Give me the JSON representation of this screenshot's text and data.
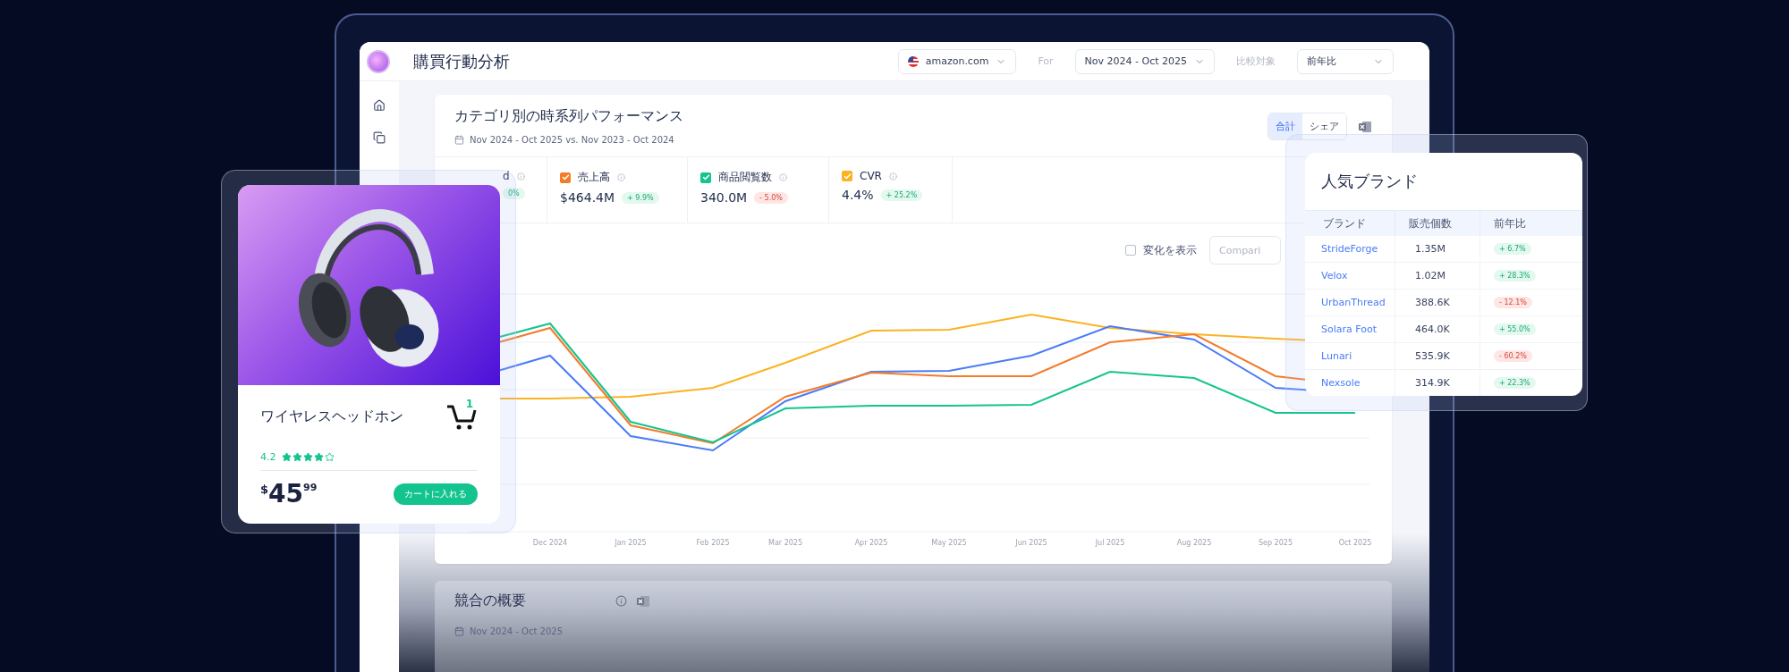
{
  "app": {
    "title": "購買行動分析",
    "marketplace": "amazon.com",
    "period_label": "For",
    "period": "Nov 2024 - Oct 2025",
    "compare_label": "比較対象",
    "compare": "前年比"
  },
  "performance_card": {
    "title": "カテゴリ別の時系列パフォーマンス",
    "date_range": "Nov 2024 - Oct 2025 vs. Nov 2023 - Oct 2024",
    "tabs": [
      {
        "label": "合計",
        "selected": true
      },
      {
        "label": "シェア",
        "selected": false
      }
    ],
    "metrics": [
      {
        "label": "d",
        "badge": {
          "text": "0%",
          "color": "#e3f8ef"
        }
      },
      {
        "label": "売上高",
        "value": "$464.4M",
        "badge": {
          "text": "+ 9.9%",
          "color": "#e3f8ef"
        },
        "checked": true,
        "color": "#f47b2a"
      },
      {
        "label": "商品閲覧数",
        "value": "340.0M",
        "badge": {
          "text": "- 5.0%",
          "color": "#fde6e4"
        },
        "checked": true,
        "color": "#14c48e"
      },
      {
        "label": "CVR",
        "value": "4.4%",
        "badge": {
          "text": "+ 25.2%",
          "color": "#e3f8ef"
        },
        "checked": true,
        "color": "#fbb321"
      }
    ],
    "show_change": {
      "label": "変化を表示",
      "checked": false
    },
    "comparison_field": {
      "placeholder": "Compari"
    },
    "x_labels": [
      "Dec 2024",
      "Jan 2025",
      "Feb 2025",
      "Mar 2025",
      "Apr 2025",
      "May 2025",
      "Jun 2025",
      "Jul 2025",
      "Aug 2025",
      "Sep 2025",
      "Oct 2025"
    ]
  },
  "competition_card": {
    "title": "競合の概要",
    "date_range": "Nov 2024 - Oct 2025"
  },
  "product_card": {
    "name": "ワイヤレスヘッドホン",
    "cart_count": "1",
    "rating": "4.2",
    "stars": 4,
    "price": {
      "currency": "$",
      "whole": "45",
      "cents": "99"
    },
    "button": "カートに入れる"
  },
  "brands_popup": {
    "title": "人気ブランド",
    "columns": [
      "ブランド",
      "販売個数",
      "前年比"
    ],
    "rows": [
      {
        "brand": "StrideForge",
        "units": "1.35M",
        "change": "+ 6.7%",
        "color": "#e3f8ef"
      },
      {
        "brand": "Velox",
        "units": "1.02M",
        "change": "+ 28.3%",
        "color": "#e3f8ef"
      },
      {
        "brand": "UrbanThread",
        "units": "388.6K",
        "change": "- 12.1%",
        "color": "#fde6e4"
      },
      {
        "brand": "Solara Foot",
        "units": "464.0K",
        "change": "+ 55.0%",
        "color": "#e3f8ef"
      },
      {
        "brand": "Lunari",
        "units": "535.9K",
        "change": "- 60.2%",
        "color": "#fde6e4"
      },
      {
        "brand": "Nexsole",
        "units": "314.9K",
        "change": "+ 22.3%",
        "color": "#e3f8ef"
      }
    ]
  }
}
